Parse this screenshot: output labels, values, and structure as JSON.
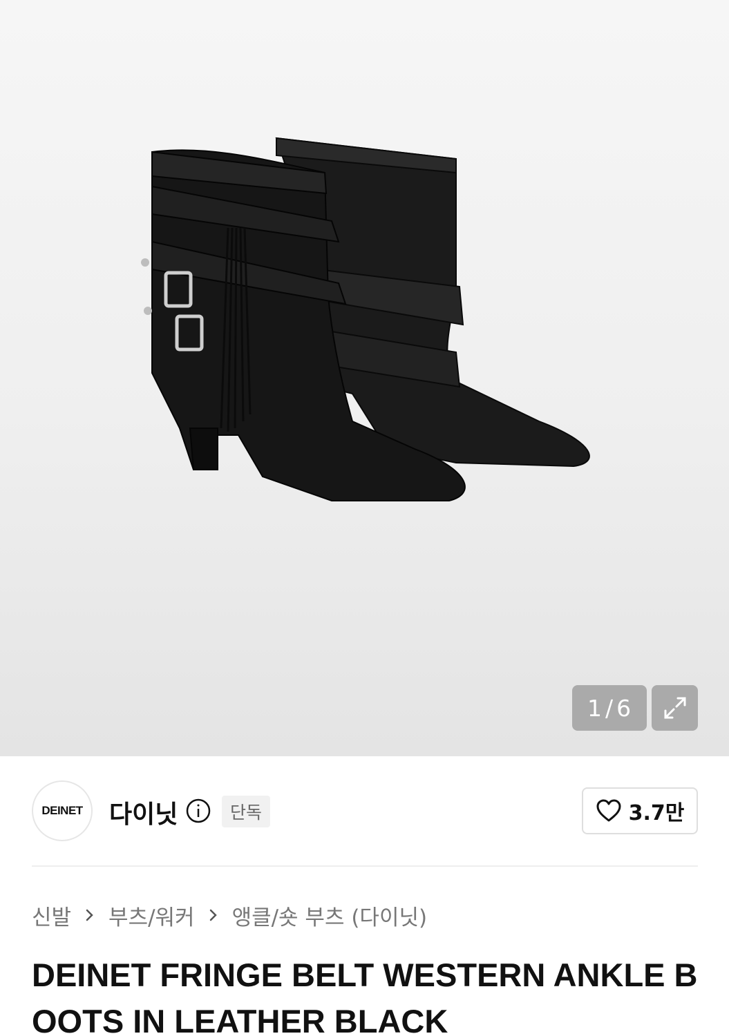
{
  "gallery": {
    "current": "1",
    "separator": "/",
    "total": "6",
    "image_alt": "black leather ankle boots with fringe and belts",
    "expand_icon": "expand-icon"
  },
  "brand": {
    "logo_text": "DEINET",
    "name": "다이닛",
    "info_icon": "info-icon",
    "badge": "단독"
  },
  "like": {
    "icon": "heart-icon",
    "count": "3.7만"
  },
  "breadcrumb": {
    "items": [
      "신발",
      "부츠/워커",
      "앵클/숏 부츠 (다이닛)"
    ],
    "separator_icon": "chevron-right-icon"
  },
  "product": {
    "title": "DEINET FRINGE BELT WESTERN ANKLE BOOTS IN LEATHER BLACK"
  }
}
